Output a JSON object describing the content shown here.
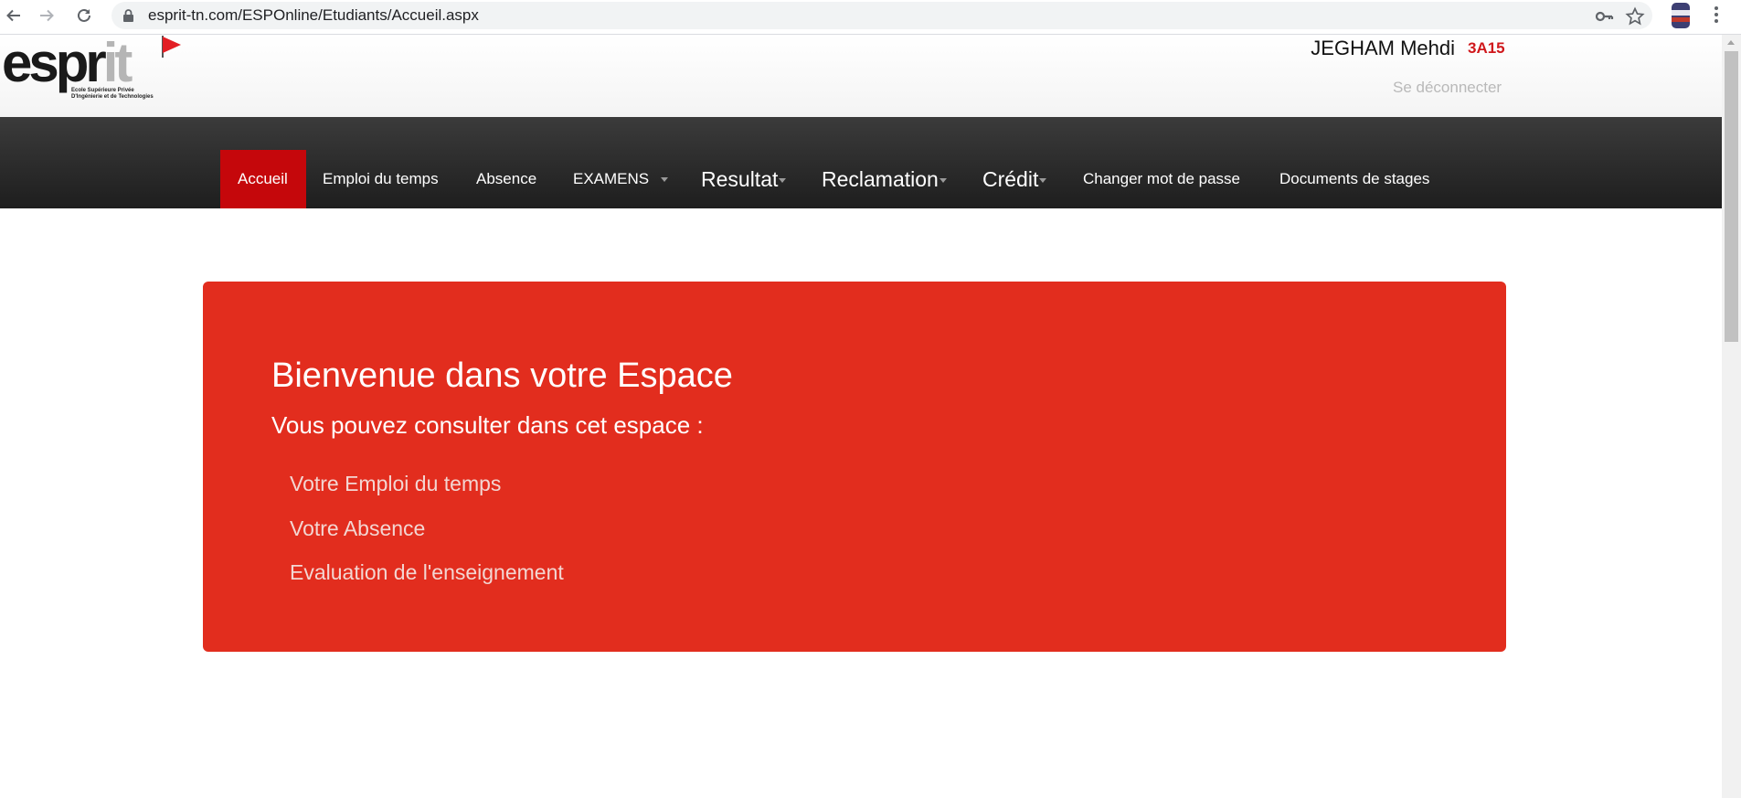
{
  "browser": {
    "url": "esprit-tn.com/ESPOnline/Etudiants/Accueil.aspx"
  },
  "header": {
    "logo_word_main": "espr",
    "logo_word_accent": "it",
    "logo_subtitle_line1": "Ecole Supérieure Privée",
    "logo_subtitle_line2": "D'Ingénierie et de Technologies",
    "user_name": "JEGHAM Mehdi",
    "user_class": "3A15",
    "logout_label": "Se déconnecter"
  },
  "nav": {
    "items": [
      {
        "label": "Accueil",
        "active": true
      },
      {
        "label": "Emploi du temps"
      },
      {
        "label": "Absence"
      },
      {
        "label": "EXAMENS",
        "dropdown": true
      },
      {
        "label": "Resultat",
        "dropdown": true
      },
      {
        "label": "Reclamation",
        "dropdown": true
      },
      {
        "label": "Crédit",
        "dropdown": true
      },
      {
        "label": "Changer mot de passe"
      },
      {
        "label": "Documents de stages"
      }
    ]
  },
  "welcome": {
    "title": "Bienvenue dans votre Espace",
    "subtitle": "Vous pouvez consulter dans cet espace :",
    "links": [
      "Votre Emploi du temps",
      "Votre Absence",
      "Evaluation de l'enseignement"
    ]
  },
  "icons": {
    "back": "arrow-left-icon",
    "forward": "arrow-right-icon",
    "reload": "reload-icon",
    "lock": "lock-icon",
    "key": "key-icon",
    "star": "star-icon",
    "menu": "kebab-menu-icon"
  },
  "colors": {
    "accent_red": "#e22d1e",
    "active_nav": "#c5070b",
    "nav_bg": "#2b2b2b",
    "class_code": "#d0181c"
  }
}
